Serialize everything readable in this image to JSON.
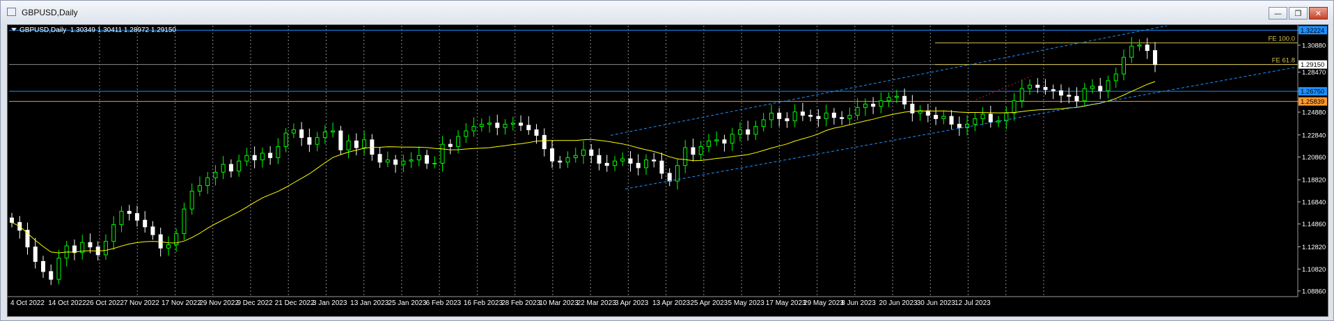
{
  "window": {
    "title": "GBPUSD,Daily"
  },
  "window_buttons": {
    "minimize": "—",
    "restore": "❐",
    "close": "✕"
  },
  "chart_header": {
    "symbol": "GBPUSD,Daily",
    "ohlc": "1.30349 1.30411 1.28972 1.29150"
  },
  "colors": {
    "bg": "#000000",
    "bull": "#00ff00",
    "bear": "#ffffff",
    "ma": "#ffff00",
    "channel": "#1e90ff",
    "fe": "#d4c24c",
    "level_blue": "#1e90ff",
    "level_orange": "#ff9a2e",
    "grid": "#8c8c8c"
  },
  "chart_data": {
    "type": "candlestick",
    "symbol": "GBPUSD",
    "timeframe": "Daily",
    "ylim": [
      1.0835,
      1.3262
    ],
    "y_ticks": [
      "1.32224",
      "1.30880",
      "1.28470",
      "1.26750",
      "1.25839",
      "1.24880",
      "1.22840",
      "1.20860",
      "1.18820",
      "1.16840",
      "1.14860",
      "1.12820",
      "1.10820",
      "1.08860"
    ],
    "x_ticks": [
      "4 Oct 2022",
      "14 Oct 2022",
      "26 Oct 2022",
      "7 Nov 2022",
      "17 Nov 2022",
      "29 Nov 2022",
      "9 Dec 2022",
      "21 Dec 2022",
      "3 Jan 2023",
      "13 Jan 2023",
      "25 Jan 2023",
      "6 Feb 2023",
      "16 Feb 2023",
      "28 Feb 2023",
      "10 Mar 2023",
      "22 Mar 2023",
      "3 Apr 2023",
      "13 Apr 2023",
      "25 Apr 2023",
      "5 May 2023",
      "17 May 2023",
      "29 May 2023",
      "8 Jun 2023",
      "20 Jun 2023",
      "30 Jun 2023",
      "12 Jul 2023"
    ],
    "close_series": [
      1.15,
      1.143,
      1.128,
      1.115,
      1.106,
      1.099,
      1.118,
      1.129,
      1.123,
      1.132,
      1.128,
      1.121,
      1.133,
      1.148,
      1.16,
      1.158,
      1.152,
      1.146,
      1.139,
      1.127,
      1.13,
      1.14,
      1.162,
      1.178,
      1.183,
      1.19,
      1.195,
      1.202,
      1.196,
      1.205,
      1.21,
      1.206,
      1.212,
      1.208,
      1.218,
      1.23,
      1.233,
      1.226,
      1.22,
      1.226,
      1.231,
      1.232,
      1.215,
      1.223,
      1.217,
      1.224,
      1.211,
      1.204,
      1.206,
      1.202,
      1.205,
      1.206,
      1.21,
      1.203,
      1.203,
      1.22,
      1.218,
      1.227,
      1.232,
      1.236,
      1.238,
      1.239,
      1.235,
      1.238,
      1.239,
      1.237,
      1.233,
      1.228,
      1.216,
      1.205,
      1.204,
      1.208,
      1.21,
      1.215,
      1.21,
      1.203,
      1.201,
      1.205,
      1.207,
      1.203,
      1.199,
      1.206,
      1.205,
      1.194,
      1.187,
      1.201,
      1.217,
      1.211,
      1.218,
      1.223,
      1.224,
      1.221,
      1.229,
      1.233,
      1.229,
      1.236,
      1.242,
      1.248,
      1.243,
      1.241,
      1.249,
      1.246,
      1.245,
      1.243,
      1.248,
      1.244,
      1.243,
      1.246,
      1.253,
      1.256,
      1.254,
      1.259,
      1.262,
      1.263,
      1.256,
      1.248,
      1.25,
      1.246,
      1.243,
      1.245,
      1.238,
      1.235,
      1.238,
      1.243,
      1.247,
      1.24,
      1.241,
      1.248,
      1.259,
      1.27,
      1.273,
      1.271,
      1.269,
      1.268,
      1.264,
      1.263,
      1.259,
      1.27,
      1.272,
      1.268,
      1.277,
      1.283,
      1.298,
      1.308,
      1.309,
      1.304,
      1.2915
    ],
    "ma_period_label": "",
    "fibo": [
      {
        "label": "FE 100.0",
        "value": 1.3108
      },
      {
        "label": "FE 61.8",
        "value": 1.2915
      }
    ],
    "price_labels": [
      {
        "value": "1.32224",
        "kind": "level-blue"
      },
      {
        "value": "1.29150",
        "kind": "bid"
      },
      {
        "value": "1.26750",
        "kind": "level-blue"
      },
      {
        "value": "1.25839",
        "kind": "level-orange"
      }
    ]
  }
}
